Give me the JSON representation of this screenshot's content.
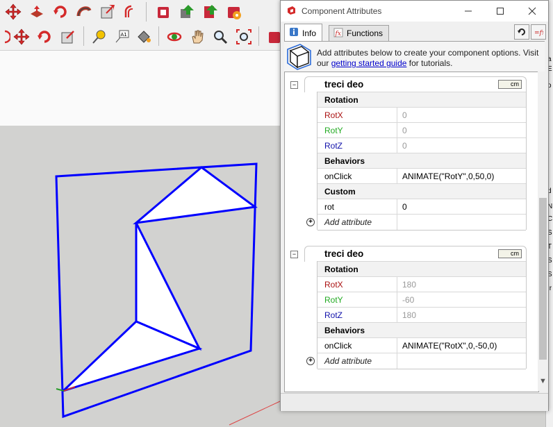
{
  "dialog": {
    "title": "Component Attributes",
    "tabs": [
      {
        "label": "Info",
        "icon": "info-icon",
        "active": true
      },
      {
        "label": "Functions",
        "icon": "function-icon",
        "active": false
      }
    ],
    "info_text_before": "Add attributes below to create your component options. Visit our ",
    "info_link": "getting started guide",
    "info_text_after": " for tutorials."
  },
  "components": [
    {
      "name": "treci deo",
      "unit": "cm",
      "groups": [
        {
          "label": "Rotation",
          "rows": [
            {
              "label": "RotX",
              "value": "0",
              "color": "#aa1111"
            },
            {
              "label": "RotY",
              "value": "0",
              "color": "#22aa22"
            },
            {
              "label": "RotZ",
              "value": "0",
              "color": "#1111aa"
            }
          ]
        },
        {
          "label": "Behaviors",
          "rows": [
            {
              "label": "onClick",
              "value": "ANIMATE(\"RotY\",0,50,0)"
            }
          ]
        },
        {
          "label": "Custom",
          "rows": [
            {
              "label": "rot",
              "value": "0"
            }
          ]
        }
      ],
      "add_label": "Add attribute"
    },
    {
      "name": "treci deo",
      "unit": "cm",
      "groups": [
        {
          "label": "Rotation",
          "rows": [
            {
              "label": "RotX",
              "value": "180",
              "color": "#aa1111"
            },
            {
              "label": "RotY",
              "value": "-60",
              "color": "#22aa22"
            },
            {
              "label": "RotZ",
              "value": "180",
              "color": "#1111aa"
            }
          ]
        },
        {
          "label": "Behaviors",
          "rows": [
            {
              "label": "onClick",
              "value": "ANIMATE(\"RotX\",0,-50,0)"
            }
          ]
        }
      ],
      "add_label": "Add attribute"
    }
  ],
  "background": {
    "edge_color": "#0000ff",
    "sky_color": "#fafafa",
    "ground_color": "#d2d2d0",
    "right_strip_letters": [
      "a",
      "E",
      "o",
      "d",
      "N",
      "C",
      "S",
      "T",
      "S",
      "S",
      "Ir"
    ]
  }
}
